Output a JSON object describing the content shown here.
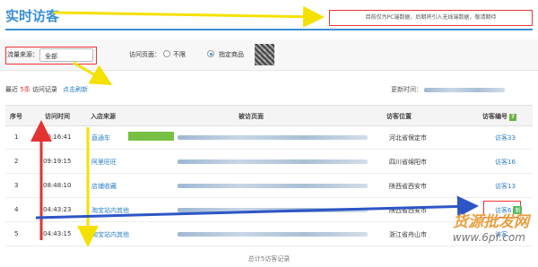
{
  "header": {
    "title": "实时访客",
    "notice": "目前仅为PC端数据，后期将引入无线端数据，敬请期待"
  },
  "filters": {
    "source_label": "流量来源：",
    "source_value": "全部",
    "page_label": "访问页面：",
    "option_unlimited": "不限",
    "option_specified": "指定商品"
  },
  "summary": {
    "prefix": "最近",
    "count": "5条",
    "suffix": "访问记录",
    "refresh": "点击刷新",
    "updated_label": "更新时间："
  },
  "table": {
    "headers": [
      "序号",
      "访问时间",
      "入店来源",
      "被访页面",
      "访客位置",
      "访客编号"
    ],
    "rows": [
      {
        "index": "1",
        "time": "10:16:41",
        "source": "直通车",
        "location": "河北省保定市",
        "visitor": "访客33"
      },
      {
        "index": "2",
        "time": "09:19:15",
        "source": "阿里旺旺",
        "location": "四川省绵阳市",
        "visitor": "访客16"
      },
      {
        "index": "3",
        "time": "08:48:10",
        "source": "店铺收藏",
        "location": "陕西省西安市",
        "visitor": "访客13"
      },
      {
        "index": "4",
        "time": "04:43:23",
        "source": "淘宝站内其他",
        "location": "陕西省西安市",
        "visitor": "访客6",
        "badge": "新"
      },
      {
        "index": "5",
        "time": "04:43:15",
        "source": "淘宝站内其他",
        "location": "浙江省舟山市",
        "visitor": "访客..."
      }
    ]
  },
  "footer": {
    "text": "总计5访客记录"
  },
  "watermark": {
    "text1": "货源批发网",
    "text2": "www.6pf.com"
  },
  "colors": {
    "accent": "#3a8fd6",
    "annotation_red": "#e33333",
    "annotation_yellow": "#f5e100",
    "annotation_blue": "#2d55c6"
  }
}
